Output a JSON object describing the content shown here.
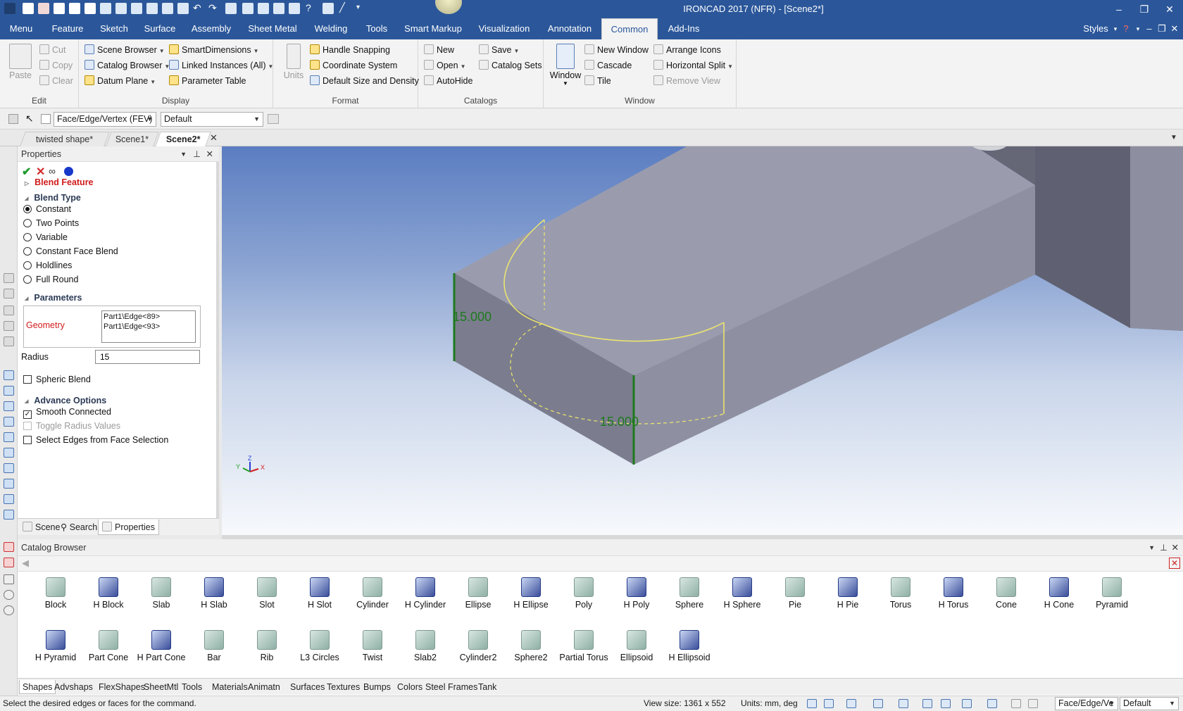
{
  "app": {
    "title": "IRONCAD 2017 (NFR) - [Scene2*]"
  },
  "menu_tabs": [
    "Menu",
    "Feature",
    "Sketch",
    "Surface",
    "Assembly",
    "Sheet Metal",
    "Welding",
    "Tools",
    "Smart Markup",
    "Visualization",
    "Annotation",
    "Common",
    "Add-Ins"
  ],
  "menu_active": "Common",
  "menu_right": {
    "styles": "Styles"
  },
  "ribbon": {
    "edit": {
      "label": "Edit",
      "paste": "Paste",
      "cut": "Cut",
      "copy": "Copy",
      "clear": "Clear"
    },
    "display": {
      "label": "Display",
      "scene_browser": "Scene Browser",
      "catalog_browser": "Catalog Browser",
      "datum_plane": "Datum Plane",
      "smart_dimensions": "SmartDimensions",
      "linked_instances": "Linked Instances (All)",
      "parameter_table": "Parameter Table"
    },
    "format": {
      "label": "Format",
      "units": "Units",
      "handle_snapping": "Handle Snapping",
      "coordinate_system": "Coordinate System",
      "default_size": "Default Size and Density"
    },
    "catalogs": {
      "label": "Catalogs",
      "new": "New",
      "open": "Open",
      "autohide": "AutoHide",
      "save": "Save",
      "catalog_sets": "Catalog Sets"
    },
    "window": {
      "label": "Window",
      "window": "Window",
      "new_window": "New Window",
      "cascade": "Cascade",
      "tile": "Tile",
      "arrange_icons": "Arrange Icons",
      "horizontal_split": "Horizontal Split",
      "remove_view": "Remove View"
    }
  },
  "selection_bar": {
    "filter": "Face/Edge/Vertex (FEV)",
    "config": "Default"
  },
  "doc_tabs": [
    "twisted shape*",
    "Scene1*",
    "Scene2*"
  ],
  "doc_active": "Scene2*",
  "properties": {
    "title": "Properties",
    "feature": "Blend Feature",
    "blend_type_header": "Blend Type",
    "blend_types": [
      "Constant",
      "Two Points",
      "Variable",
      "Constant Face Blend",
      "Holdlines",
      "Full Round"
    ],
    "blend_selected": "Constant",
    "parameters_header": "Parameters",
    "geometry_label": "Geometry",
    "geometry_items": [
      "Part1\\Edge<89>",
      "Part1\\Edge<93>"
    ],
    "radius_label": "Radius",
    "radius_value": "15",
    "spheric_blend": "Spheric Blend",
    "advance_header": "Advance Options",
    "smooth_connected": "Smooth Connected",
    "toggle_radius": "Toggle Radius Values",
    "select_edges": "Select Edges from Face Selection",
    "bottom_tabs": [
      "Scene",
      "Search",
      "Properties"
    ]
  },
  "viewport": {
    "dim1": "15.000",
    "dim2": "15.000",
    "axes": {
      "z": "Z",
      "y": "Y",
      "x": "X"
    }
  },
  "catalog": {
    "title": "Catalog Browser",
    "row1": [
      "Block",
      "H Block",
      "Slab",
      "H Slab",
      "Slot",
      "H Slot",
      "Cylinder",
      "H Cylinder",
      "Ellipse",
      "H Ellipse",
      "Poly",
      "H Poly",
      "Sphere",
      "H Sphere",
      "Pie",
      "H Pie",
      "Torus",
      "H Torus",
      "Cone",
      "H Cone",
      "Pyramid"
    ],
    "row2": [
      "H Pyramid",
      "Part Cone",
      "H Part Cone",
      "Bar",
      "Rib",
      "L3 Circles",
      "Twist",
      "Slab2",
      "Cylinder2",
      "Sphere2",
      "Partial Torus",
      "Ellipsoid",
      "H Ellipsoid"
    ],
    "tabs": [
      "Shapes",
      "Advshaps",
      "FlexShapes",
      "SheetMtl",
      "Tools",
      "Materials",
      "Animatn",
      "Surfaces",
      "Textures",
      "Bumps",
      "Colors",
      "Steel Frames",
      "Tank"
    ],
    "active_tab": "Shapes"
  },
  "status": {
    "message": "Select the desired edges or faces for the command.",
    "view_size": "View size: 1361 x  552",
    "units": "Units: mm, deg",
    "filter": "Face/Edge/Ve",
    "config": "Default"
  }
}
